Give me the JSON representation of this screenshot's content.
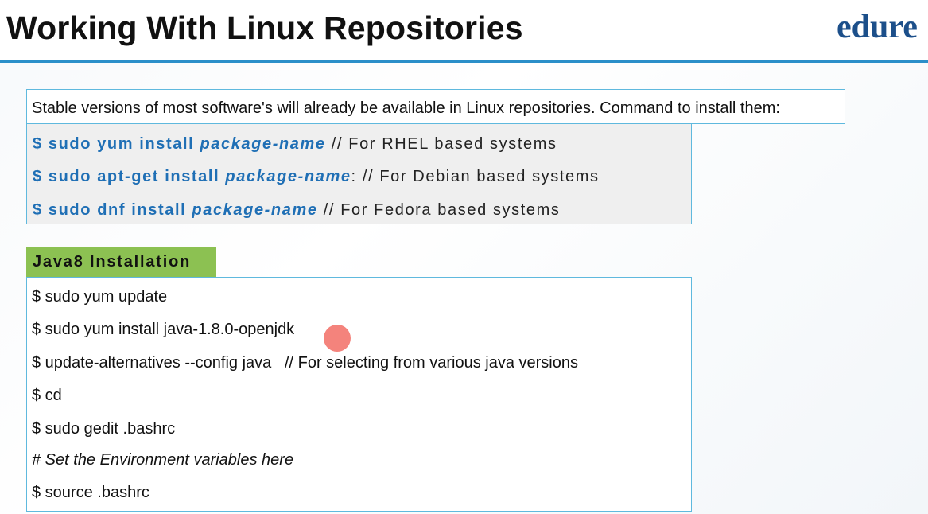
{
  "header": {
    "title": "Working With Linux Repositories",
    "logo": "edure"
  },
  "intro": {
    "text": "Stable versions of most software's will already be available in Linux repositories. Command to install them:"
  },
  "repo_commands": [
    {
      "cmd": "$ sudo yum install ",
      "pkg": "package-name",
      "sep": " ",
      "comment": "// For RHEL based systems"
    },
    {
      "cmd": "$ sudo apt-get install ",
      "pkg": "package-name",
      "sep": ": ",
      "comment": "// For Debian based systems"
    },
    {
      "cmd": "$ sudo dnf install ",
      "pkg": "package-name",
      "sep": " ",
      "comment": "// For Fedora based systems"
    }
  ],
  "java_section": {
    "title": "Java8 Installation",
    "lines": [
      "$ sudo yum update",
      "$ sudo yum install java-1.8.0-openjdk",
      "$ update-alternatives --config java   // For selecting from various java versions",
      "$ cd",
      "$ sudo gedit .bashrc",
      "# Set the Environment variables here",
      "$ source .bashrc"
    ]
  },
  "colors": {
    "accent_blue": "#2b8fc9",
    "command_blue": "#1f6fb5",
    "section_green": "#8cc152",
    "logo_navy": "#1c4f8a",
    "cursor_red": "#f05a50"
  }
}
